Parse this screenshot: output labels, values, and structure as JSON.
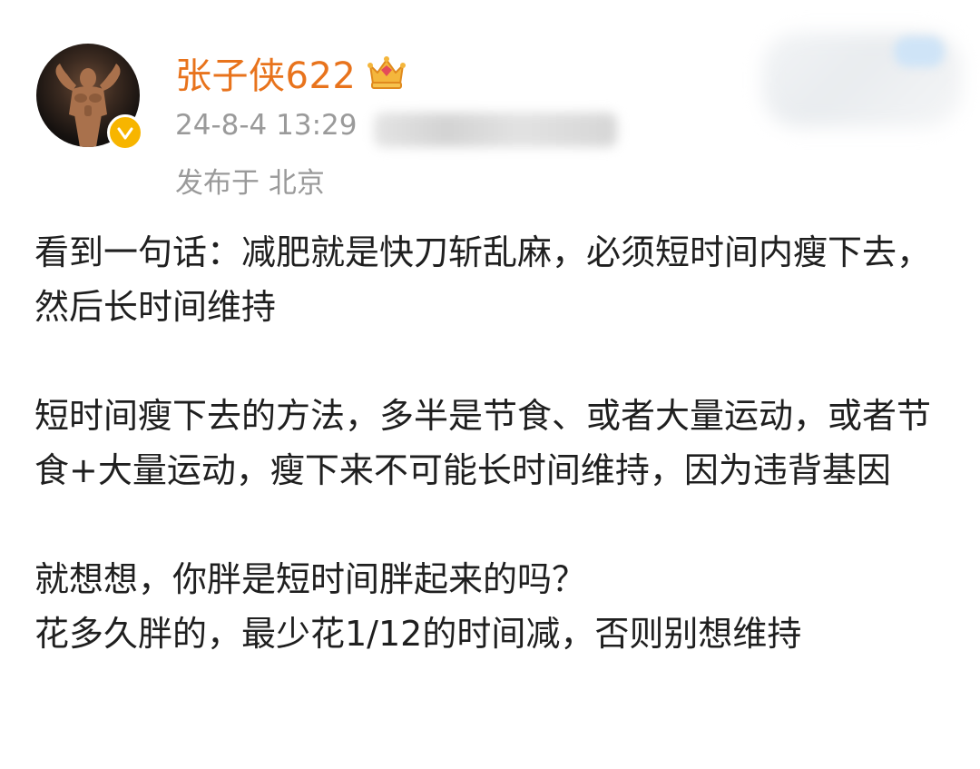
{
  "post": {
    "author": {
      "name": "张子侠622",
      "avatar_icon": "bodybuilder-avatar",
      "verified_icon": "verified-badge-icon",
      "member_icon": "crown-badge-icon",
      "accent_color": "#e8731c"
    },
    "timestamp": "24-8-4 13:29",
    "location": "发布于 北京",
    "paragraphs": [
      "看到一句话：减肥就是快刀斩乱麻，必须短时间内瘦下去，然后长时间维持",
      "短时间瘦下去的方法，多半是节食、或者大量运动，或者节食+大量运动，瘦下来不可能长时间维持，因为违背基因",
      "就想想，你胖是短时间胖起来的吗？",
      "花多久胖的，最少花1/12的时间减，否则别想维持"
    ]
  }
}
